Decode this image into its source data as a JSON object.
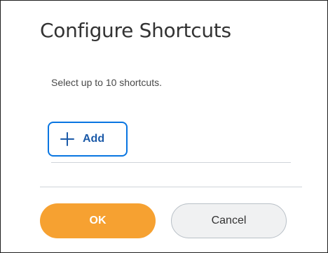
{
  "dialog": {
    "title": "Configure Shortcuts",
    "instruction": "Select up to 10 shortcuts."
  },
  "add_button": {
    "label": "Add",
    "icon": "plus-icon",
    "accent_color": "#0875e1"
  },
  "footer": {
    "ok_label": "OK",
    "cancel_label": "Cancel",
    "ok_color": "#f6a131"
  }
}
